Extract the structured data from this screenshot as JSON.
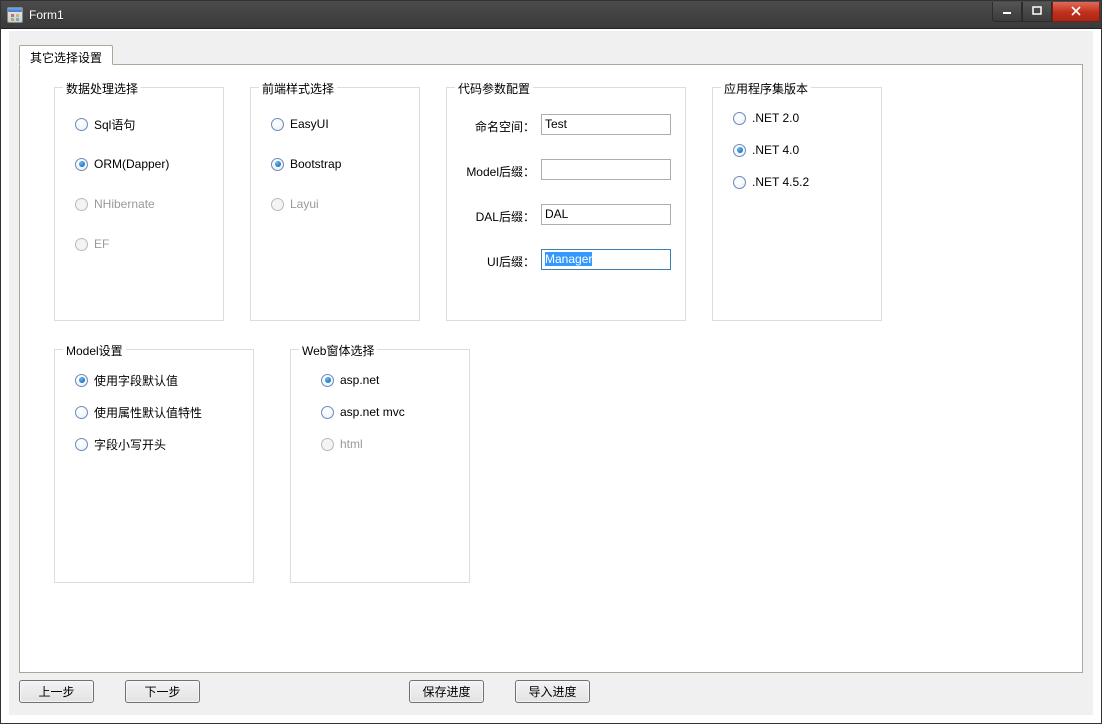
{
  "window": {
    "title": "Form1"
  },
  "tab": {
    "label": "其它选择设置"
  },
  "groups": {
    "data_proc": {
      "title": "数据处理选择",
      "opts": {
        "sql": {
          "label": "Sql语句",
          "checked": false,
          "disabled": false
        },
        "orm": {
          "label": "ORM(Dapper)",
          "checked": true,
          "disabled": false
        },
        "nhib": {
          "label": "NHibernate",
          "checked": false,
          "disabled": true
        },
        "ef": {
          "label": "EF",
          "checked": false,
          "disabled": true
        }
      }
    },
    "front_style": {
      "title": "前端样式选择",
      "opts": {
        "easyui": {
          "label": "EasyUI",
          "checked": false,
          "disabled": false
        },
        "bootstrap": {
          "label": "Bootstrap",
          "checked": true,
          "disabled": false
        },
        "layui": {
          "label": "Layui",
          "checked": false,
          "disabled": true
        }
      }
    },
    "code_params": {
      "title": "代码参数配置",
      "fields": {
        "ns": {
          "label": "命名空间：",
          "value": "Test"
        },
        "model": {
          "label": "Model后缀：",
          "value": ""
        },
        "dal": {
          "label": "DAL后缀：",
          "value": "DAL"
        },
        "ui": {
          "label": "UI后缀：",
          "value": "Manager"
        }
      }
    },
    "assembly_ver": {
      "title": "应用程序集版本",
      "opts": {
        "net20": {
          "label": ".NET 2.0",
          "checked": false
        },
        "net40": {
          "label": ".NET 4.0",
          "checked": true
        },
        "net452": {
          "label": ".NET 4.5.2",
          "checked": false
        }
      }
    },
    "model_set": {
      "title": "Model设置",
      "opts": {
        "use_field_default": {
          "label": "使用字段默认值",
          "checked": true
        },
        "use_prop_default": {
          "label": "使用属性默认值特性",
          "checked": false
        },
        "lower_first": {
          "label": "字段小写开头",
          "checked": false
        }
      }
    },
    "web_form": {
      "title": "Web窗体选择",
      "opts": {
        "aspnet": {
          "label": "asp.net",
          "checked": true,
          "disabled": false
        },
        "aspnet_mvc": {
          "label": "asp.net mvc",
          "checked": false,
          "disabled": false
        },
        "html": {
          "label": "html",
          "checked": false,
          "disabled": true
        }
      }
    }
  },
  "buttons": {
    "prev": "上一步",
    "next": "下一步",
    "save": "保存进度",
    "import": "导入进度"
  }
}
